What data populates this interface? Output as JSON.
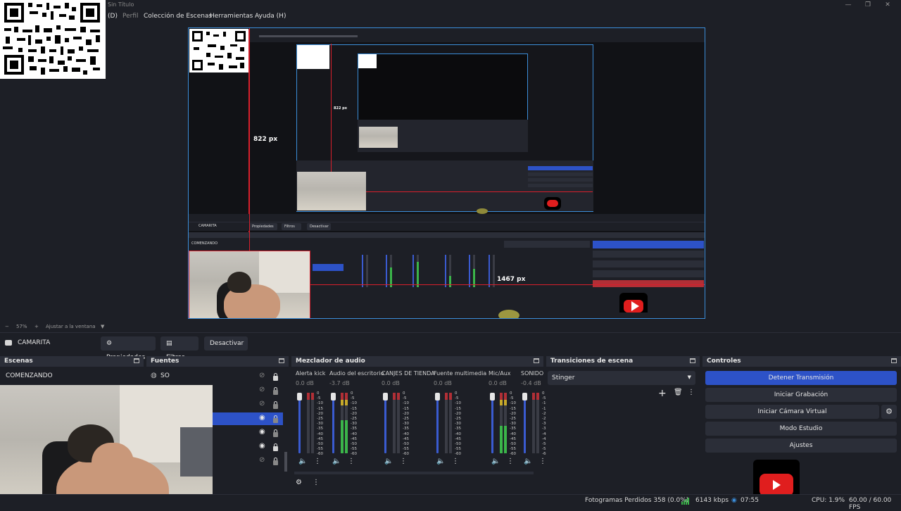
{
  "window": {
    "title": "Sin Título"
  },
  "menu": [
    {
      "label": "(D)",
      "dim": false
    },
    {
      "label": "Perfil",
      "dim": true
    },
    {
      "label": "Colección de Escenas",
      "dim": false
    },
    {
      "label": "Herramientas",
      "dim": false
    },
    {
      "label": "Ayuda (H)",
      "dim": false
    }
  ],
  "preview": {
    "measure_vertical": "822 px",
    "measure_horizontal": "1467 px",
    "nested_measure": "822 px"
  },
  "zoom": {
    "minus": "−",
    "value": "57%",
    "plus": "+",
    "fit_label": "Ajustar a la ventana"
  },
  "source_bar": {
    "source_name": "CAMARITA",
    "properties": "Propiedades",
    "filters": "Filtros",
    "deactivate": "Desactivar"
  },
  "scenes": {
    "title": "Escenas",
    "items": [
      "COMENZANDO"
    ]
  },
  "sources": {
    "title": "Fuentes",
    "first_item": "SO"
  },
  "mixer": {
    "title": "Mezclador de audio",
    "channels": [
      {
        "name": "Alerta kick",
        "db": "0.0 dB",
        "level": 0.0
      },
      {
        "name": "Audio del escritorio",
        "db": "-3.7 dB",
        "level": 0.55
      },
      {
        "name": "CANJES DE TIENDA",
        "db": "0.0 dB",
        "level": 0.0
      },
      {
        "name": "Fuente multimedia",
        "db": "0.0 dB",
        "level": 0.0
      },
      {
        "name": "Mic/Aux",
        "db": "0.0 dB",
        "level": 0.45
      },
      {
        "name": "SONIDO",
        "db": "-0.4 dB",
        "level": 0.0
      }
    ],
    "scale": [
      "0",
      "-5",
      "-10",
      "-15",
      "-20",
      "-25",
      "-30",
      "-35",
      "-40",
      "-45",
      "-50",
      "-55",
      "-60"
    ]
  },
  "transitions": {
    "title": "Transiciones de escena",
    "selected": "Stinger"
  },
  "controls": {
    "title": "Controles",
    "buttons": [
      "Detener Transmisión",
      "Iniciar Grabación",
      "Iniciar Cámara Virtual",
      "Modo Estudio",
      "Ajustes"
    ]
  },
  "status": {
    "dropped": "Fotogramas Perdidos 358 (0.0%)",
    "bitrate": "6143 kbps",
    "time": "07:55",
    "cpu": "CPU: 1.9%",
    "fps": "60.00 / 60.00 FPS"
  },
  "colors": {
    "accent": "#2d52c7",
    "selection": "#3b8dd8",
    "red_guide": "#d81f2c",
    "meter_green": "#3bb54a"
  }
}
